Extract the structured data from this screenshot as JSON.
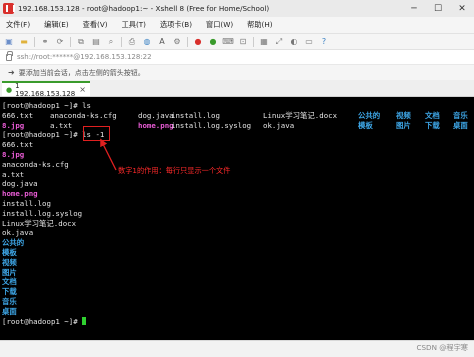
{
  "window": {
    "title": "192.168.153.128 - root@hadoop1:~ - Xshell 8 (Free for Home/School)"
  },
  "menu": [
    "文件(F)",
    "编辑(E)",
    "查看(V)",
    "工具(T)",
    "选项卡(B)",
    "窗口(W)",
    "帮助(H)"
  ],
  "address": {
    "value": "ssh://root:******@192.168.153.128:22"
  },
  "hint": {
    "text": "要添加当前会话，点击左侧的箭头按钮。"
  },
  "tab": {
    "label": "1 192.168.153.128",
    "close": "×"
  },
  "colors": {
    "dir_blue": "#3ea7e8",
    "image_magenta": "#e85bd4",
    "annotation_red": "#e02020",
    "tab_accent": "#3a9b2c"
  },
  "terminal": {
    "prompt": "[root@hadoop1 ~]# ",
    "cmd1": "ls",
    "ls_row1": [
      {
        "t": "666.txt",
        "k": "file"
      },
      {
        "t": "anaconda-ks.cfg",
        "k": "file"
      },
      {
        "t": "dog.java",
        "k": "file"
      },
      {
        "t": "install.log",
        "k": "file"
      },
      {
        "t": "Linux学习笔记.docx",
        "k": "file"
      },
      {
        "t": "公共的",
        "k": "dir"
      },
      {
        "t": "视频",
        "k": "dir"
      },
      {
        "t": "文档",
        "k": "dir"
      },
      {
        "t": "音乐",
        "k": "dir"
      }
    ],
    "ls_row2": [
      {
        "t": "8.jpg",
        "k": "img"
      },
      {
        "t": "a.txt",
        "k": "file"
      },
      {
        "t": "home.png",
        "k": "img"
      },
      {
        "t": "install.log.syslog",
        "k": "file"
      },
      {
        "t": "ok.java",
        "k": "file"
      },
      {
        "t": "模板",
        "k": "dir"
      },
      {
        "t": "图片",
        "k": "dir"
      },
      {
        "t": "下载",
        "k": "dir"
      },
      {
        "t": "桌面",
        "k": "dir"
      }
    ],
    "cmd2": "ls -1",
    "ls1_output": [
      {
        "t": "666.txt",
        "k": "file"
      },
      {
        "t": "8.jpg",
        "k": "img"
      },
      {
        "t": "anaconda-ks.cfg",
        "k": "file"
      },
      {
        "t": "a.txt",
        "k": "file"
      },
      {
        "t": "dog.java",
        "k": "file"
      },
      {
        "t": "home.png",
        "k": "img"
      },
      {
        "t": "install.log",
        "k": "file"
      },
      {
        "t": "install.log.syslog",
        "k": "file"
      },
      {
        "t": "Linux学习笔记.docx",
        "k": "file"
      },
      {
        "t": "ok.java",
        "k": "file"
      },
      {
        "t": "公共的",
        "k": "dir"
      },
      {
        "t": "模板",
        "k": "dir"
      },
      {
        "t": "视频",
        "k": "dir"
      },
      {
        "t": "图片",
        "k": "dir"
      },
      {
        "t": "文档",
        "k": "dir"
      },
      {
        "t": "下载",
        "k": "dir"
      },
      {
        "t": "音乐",
        "k": "dir"
      },
      {
        "t": "桌面",
        "k": "dir"
      }
    ],
    "final_prompt": "[root@hadoop1 ~]#"
  },
  "annotation": {
    "text": "数字1的作用：每行只显示一个文件"
  },
  "watermark": {
    "text": "CSDN @程宇寒"
  }
}
